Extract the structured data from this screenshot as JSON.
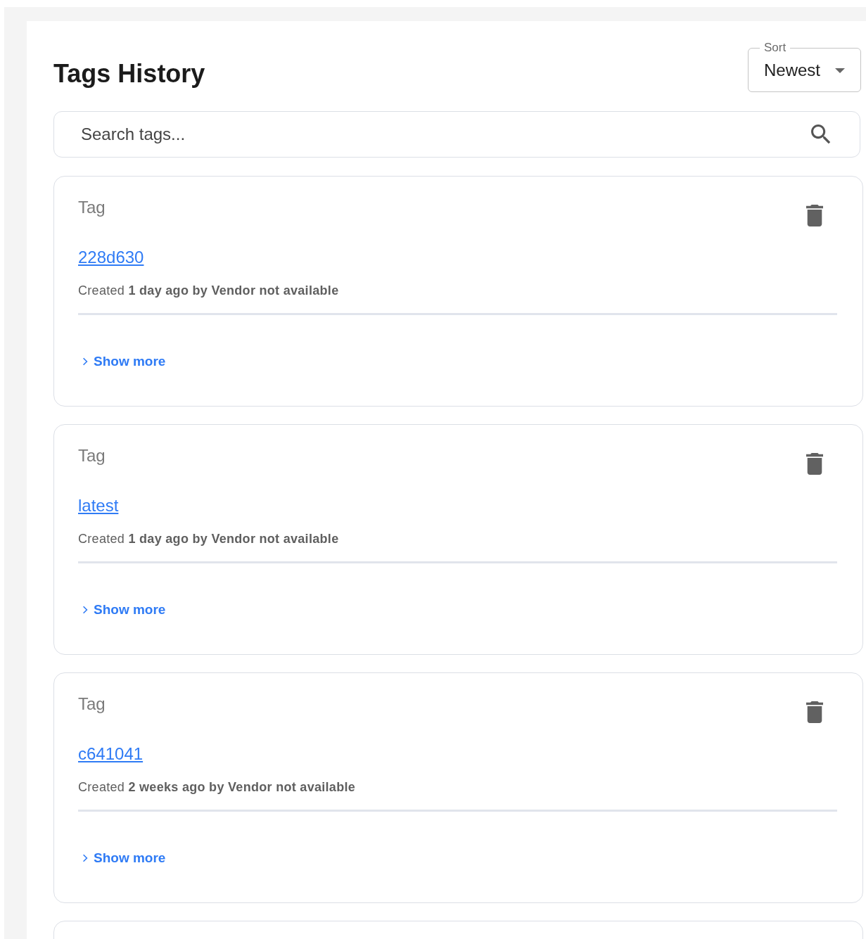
{
  "title": "Tags History",
  "sort": {
    "label": "Sort",
    "value": "Newest"
  },
  "search": {
    "placeholder": "Search tags..."
  },
  "tags": [
    {
      "label": "Tag",
      "name": "228d630",
      "created": "Created **1 day ago by Vendor not available**",
      "toggle": "Show more",
      "expanded": false
    },
    {
      "label": "Tag",
      "name": "latest",
      "created": "Created **1 day ago by Vendor not available**",
      "toggle": "Show more",
      "expanded": false
    },
    {
      "label": "Tag",
      "name": "c641041",
      "created": "Created **2 weeks ago by Vendor not available**",
      "toggle": "Show more",
      "expanded": false
    }
  ]
}
